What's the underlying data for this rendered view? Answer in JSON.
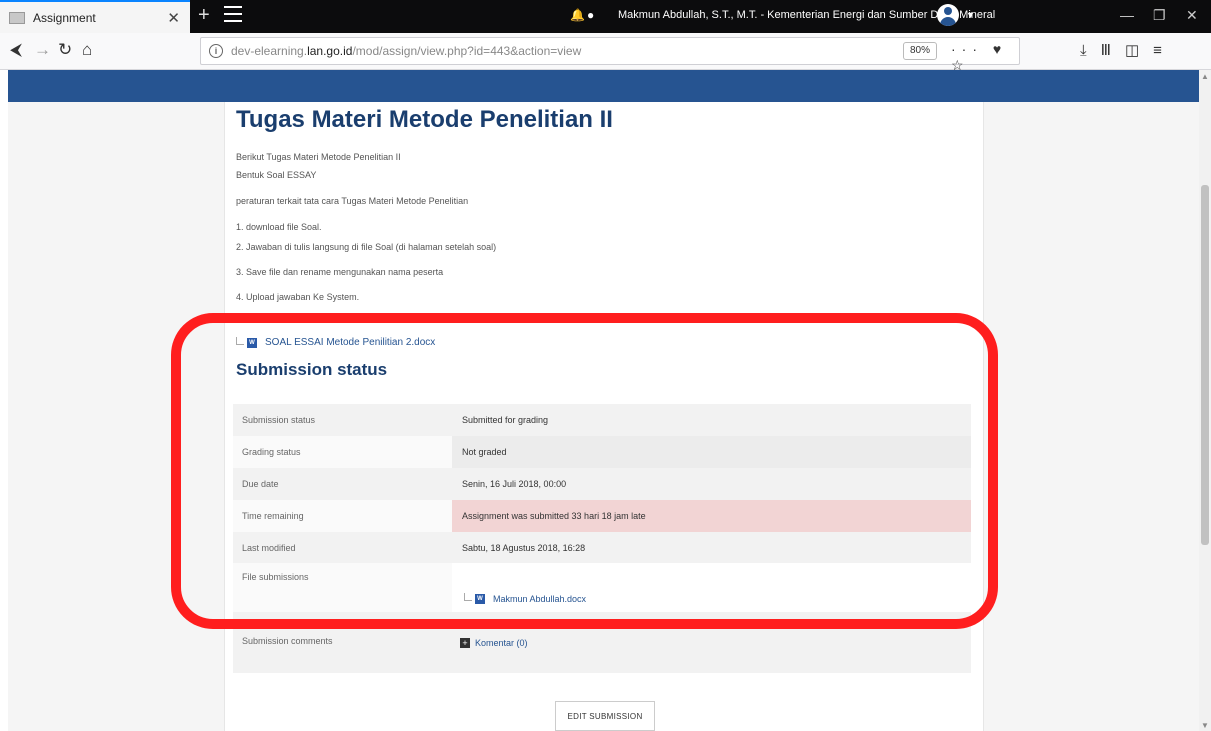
{
  "browser": {
    "tab_title": "Assignment",
    "url_prefix": "dev-elearning.",
    "url_host": "lan.go.id",
    "url_path": "/mod/assign/view.php?id=443&action=view",
    "zoom": "80%"
  },
  "header": {
    "user_name": "Makmun Abdullah, S.T., M.T. - Kementerian Energi dan Sumber Daya Mineral"
  },
  "assignment": {
    "title": "Tugas Materi Metode Penelitian II",
    "intro": [
      "Berikut Tugas Materi Metode Penelitian II",
      "Bentuk Soal ESSAY",
      "peraturan terkait tata cara Tugas Materi Metode Penelitian",
      "1. download file Soal.",
      "2. Jawaban di tulis langsung di file Soal (di halaman setelah soal)",
      "3. Save file dan rename mengunakan nama peserta",
      "4. Upload jawaban Ke System."
    ],
    "attachment": "SOAL ESSAI Metode Penilitian 2.docx"
  },
  "submission": {
    "heading": "Submission status",
    "rows": [
      {
        "label": "Submission status",
        "value": "Submitted for grading"
      },
      {
        "label": "Grading status",
        "value": "Not graded"
      },
      {
        "label": "Due date",
        "value": "Senin, 16 Juli 2018, 00:00"
      },
      {
        "label": "Time remaining",
        "value": "Assignment was submitted 33 hari 18 jam late"
      },
      {
        "label": "Last modified",
        "value": "Sabtu, 18 Agustus 2018, 16:28"
      },
      {
        "label": "File submissions",
        "value": "Makmun Abdullah.docx"
      },
      {
        "label": "Submission comments",
        "value": "Komentar (0)"
      }
    ],
    "edit_button": "EDIT SUBMISSION"
  },
  "colors": {
    "header": "#265491",
    "late_row": "#f2d4d4",
    "highlight": "#ff1e1e"
  }
}
